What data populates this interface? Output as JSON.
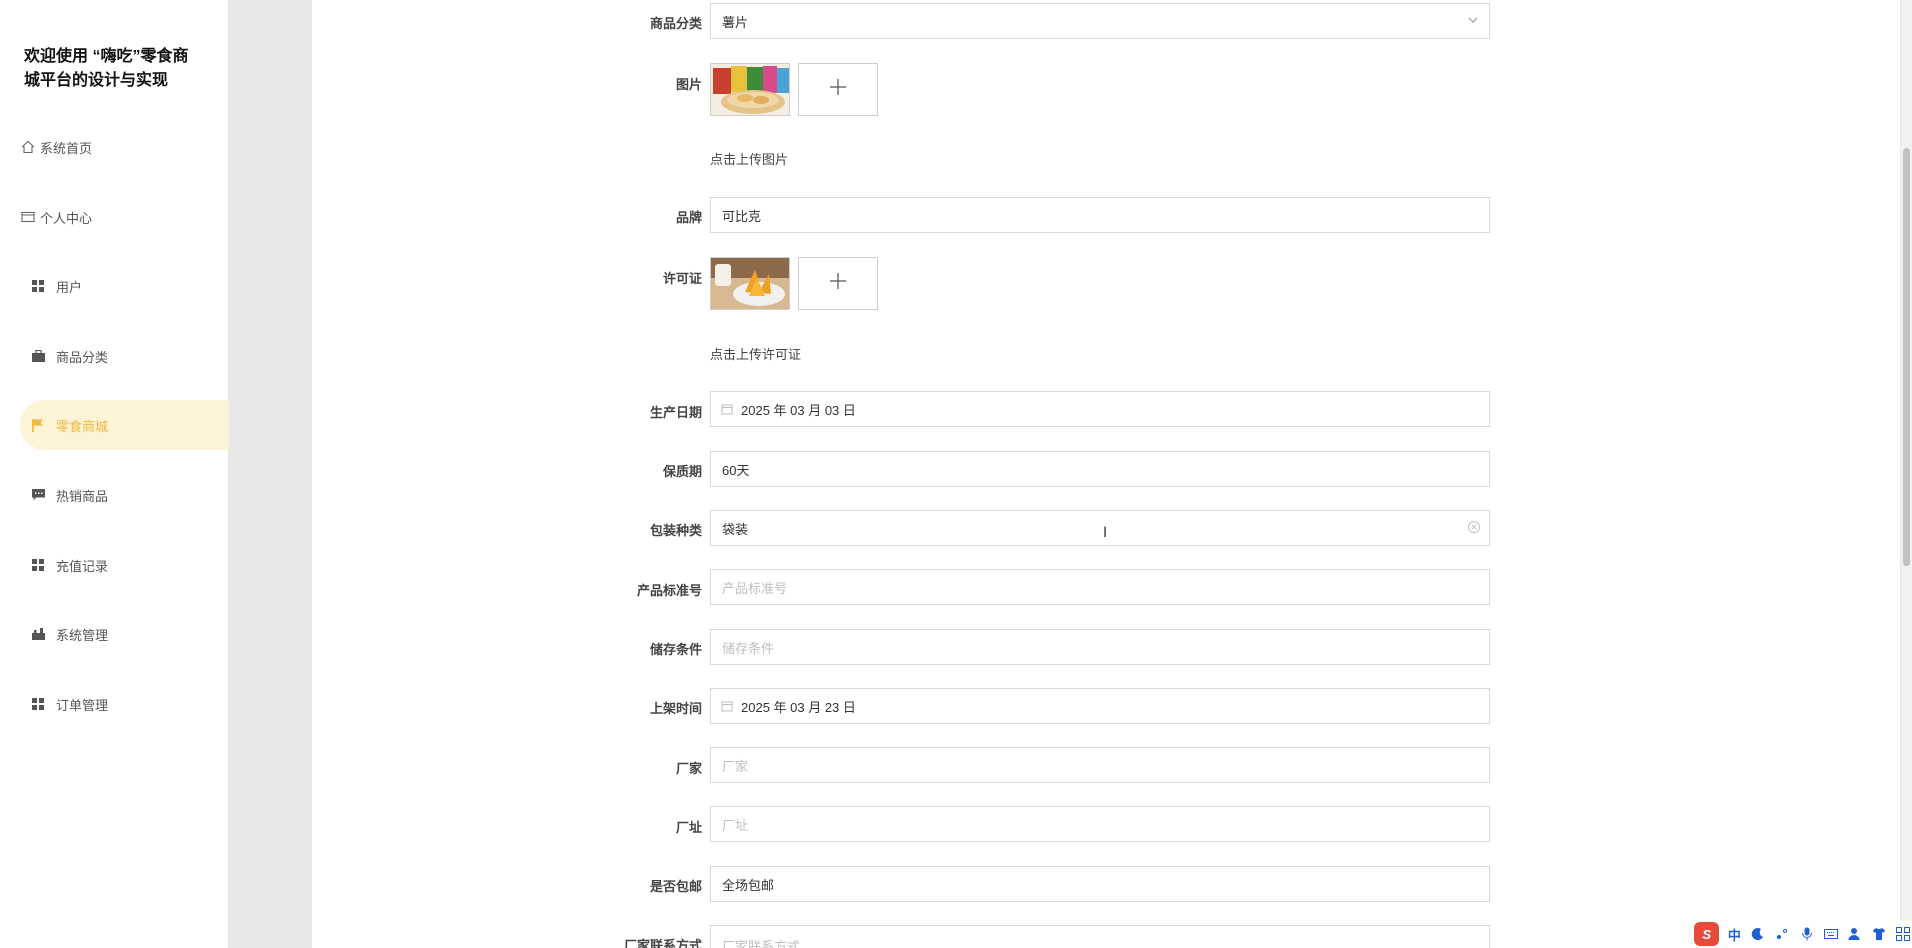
{
  "sidebar": {
    "title": "欢迎使用 “嗨吃”零食商城平台的设计与实现",
    "items": [
      {
        "label": "系统首页",
        "icon": "home-icon"
      },
      {
        "label": "个人中心",
        "icon": "id-card-icon"
      },
      {
        "label": "用户",
        "icon": "grid-icon"
      },
      {
        "label": "商品分类",
        "icon": "briefcase-icon"
      },
      {
        "label": "零食商城",
        "icon": "flag-icon",
        "active": true
      },
      {
        "label": "热销商品",
        "icon": "chat-icon"
      },
      {
        "label": "充值记录",
        "icon": "grid-icon"
      },
      {
        "label": "系统管理",
        "icon": "tools-icon"
      },
      {
        "label": "订单管理",
        "icon": "grid-icon"
      }
    ],
    "active_color": "#f0b940",
    "active_bg": "#fdf3d6"
  },
  "form": {
    "category": {
      "label": "商品分类",
      "value": "薯片"
    },
    "image": {
      "label": "图片",
      "hint": "点击上传图片"
    },
    "brand": {
      "label": "品牌",
      "value": "可比克"
    },
    "license": {
      "label": "许可证",
      "hint": "点击上传许可证"
    },
    "production_date": {
      "label": "生产日期",
      "value": "2025 年 03 月 03 日"
    },
    "shelf_life": {
      "label": "保质期",
      "value": "60天"
    },
    "packaging": {
      "label": "包装种类",
      "value": "袋装"
    },
    "standard_no": {
      "label": "产品标准号",
      "placeholder": "产品标准号"
    },
    "storage": {
      "label": "储存条件",
      "placeholder": "储存条件"
    },
    "listing_time": {
      "label": "上架时间",
      "value": "2025 年 03 月 23 日"
    },
    "manufacturer": {
      "label": "厂家",
      "placeholder": "厂家"
    },
    "factory_address": {
      "label": "厂址",
      "placeholder": "厂址"
    },
    "free_shipping": {
      "label": "是否包邮",
      "value": "全场包邮"
    },
    "manufacturer_contact": {
      "label": "厂家联系方式",
      "placeholder": "厂家联系方式"
    }
  },
  "tray": {
    "ime_logo": "S",
    "ime_mode": "中",
    "icons": [
      "moon-icon",
      "punctuation-icon",
      "microphone-icon",
      "keyboard-icon",
      "user-icon",
      "shirt-icon",
      "apps-icon"
    ]
  }
}
